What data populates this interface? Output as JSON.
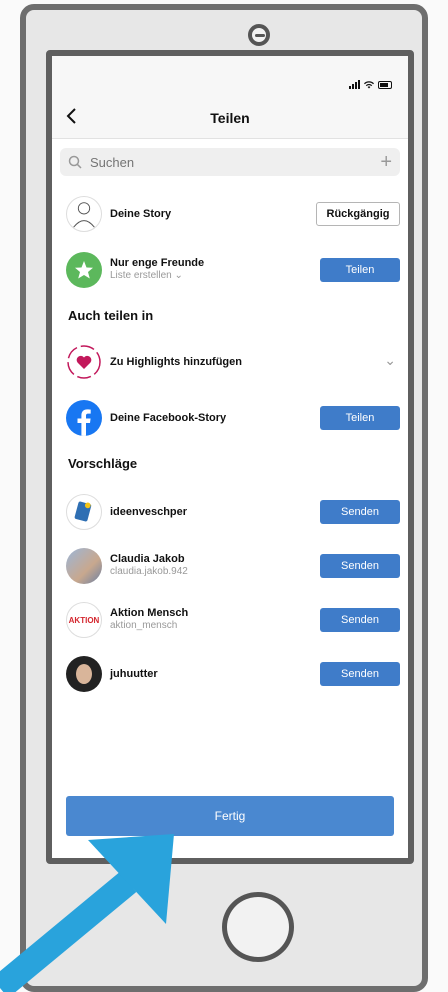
{
  "nav": {
    "title": "Teilen"
  },
  "search": {
    "placeholder": "Suchen",
    "add_symbol": "+"
  },
  "top_rows": [
    {
      "name": "Deine Story",
      "button": "Rückgängig"
    },
    {
      "name": "Nur enge Freunde",
      "sub": "Liste erstellen",
      "button": "Teilen"
    }
  ],
  "share_section": {
    "heading": "Auch teilen in",
    "items": [
      {
        "name": "Zu Highlights hinzufügen"
      },
      {
        "name": "Deine Facebook-Story",
        "button": "Teilen"
      }
    ]
  },
  "suggestions": {
    "heading": "Vorschläge",
    "items": [
      {
        "name": "ideenveschper",
        "button": "Senden"
      },
      {
        "name": "Claudia Jakob",
        "sub": "claudia.jakob.942",
        "button": "Senden"
      },
      {
        "name": "Aktion Mensch",
        "sub": "aktion_mensch",
        "button": "Senden",
        "logo_text": "AKTION"
      },
      {
        "name": "juhuutter",
        "button": "Senden"
      }
    ]
  },
  "footer": {
    "done_label": "Fertig"
  },
  "colors": {
    "accent": "#3f7cc9",
    "green": "#5cb85c",
    "highlight_pink": "#c2185b",
    "facebook": "#1877f2",
    "arrow": "#29a3dc"
  }
}
